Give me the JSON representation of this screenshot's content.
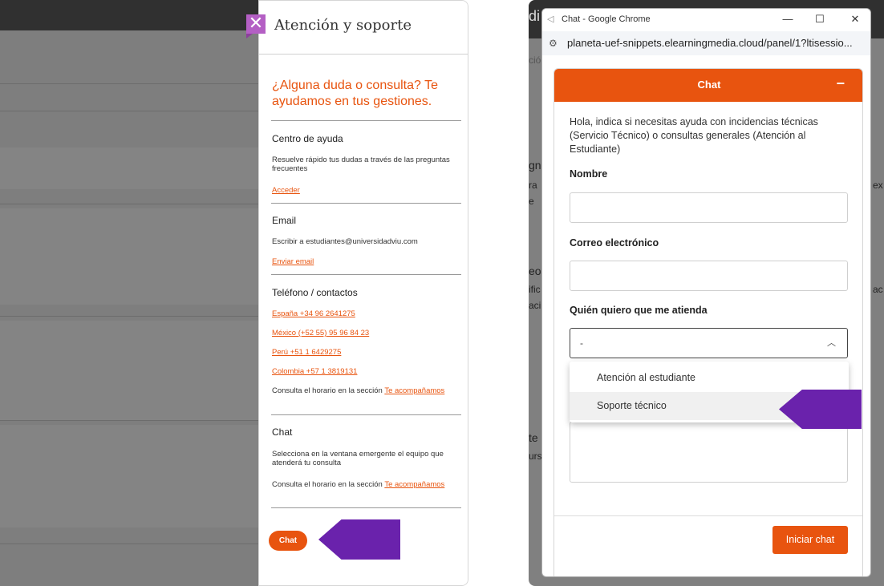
{
  "left_panel": {
    "close_glyph": "✕",
    "title": "Atención y soporte",
    "headline": "¿Alguna duda o consulta? Te ayudamos en tus gestiones.",
    "help_center": {
      "heading": "Centro de ayuda",
      "text": "Resuelve rápido tus dudas a través de las preguntas frecuentes",
      "link": "Acceder"
    },
    "email": {
      "heading": "Email",
      "text": "Escribir a estudiantes@universidadviu.com",
      "link": "Enviar email"
    },
    "phones": {
      "heading": "Teléfono / contactos",
      "items": [
        "España +34 96 2641275",
        "México (+52 55) 95 96 84 23",
        "Perú +51 1 6429275",
        "Colombia +57 1 3819131"
      ],
      "schedule_text": "Consulta el horario en la sección",
      "schedule_link": "Te acompañamos"
    },
    "chat": {
      "heading": "Chat",
      "text": "Selecciona en la ventana emergente el equipo que atenderá tu consulta",
      "schedule_text": "Consulta el horario en la sección",
      "schedule_link": "Te acompañamos",
      "button": "Chat"
    }
  },
  "browser_window": {
    "title": "Chat - Google Chrome",
    "controls": [
      "—",
      "☐",
      "✕"
    ],
    "url_icon": "⚙",
    "url": "planeta-uef-snippets.elearningmedia.cloud/panel/1?ltisessio...",
    "background_fragments": [
      "di",
      "ció",
      "gn",
      "ra",
      "e",
      "eo",
      "ific",
      "aci",
      "te",
      "urs",
      "ex",
      "ac"
    ]
  },
  "chat_form": {
    "header_title": "Chat",
    "minimize": "−",
    "intro": "Hola, indica si necesitas ayuda con incidencias técnicas (Servicio Técnico) o consultas generales (Atención al Estudiante)",
    "name_label": "Nombre",
    "email_label": "Correo electrónico",
    "attend_label": "Quién quiero que me atienda",
    "select_value": "-",
    "chevron": "︿",
    "options": [
      "Atención al estudiante",
      "Soporte técnico"
    ],
    "start_button": "Iniciar chat"
  },
  "colors": {
    "accent": "#e8540f",
    "pointer_arrow": "#6a22ac",
    "close_button": "#b45fc4"
  }
}
